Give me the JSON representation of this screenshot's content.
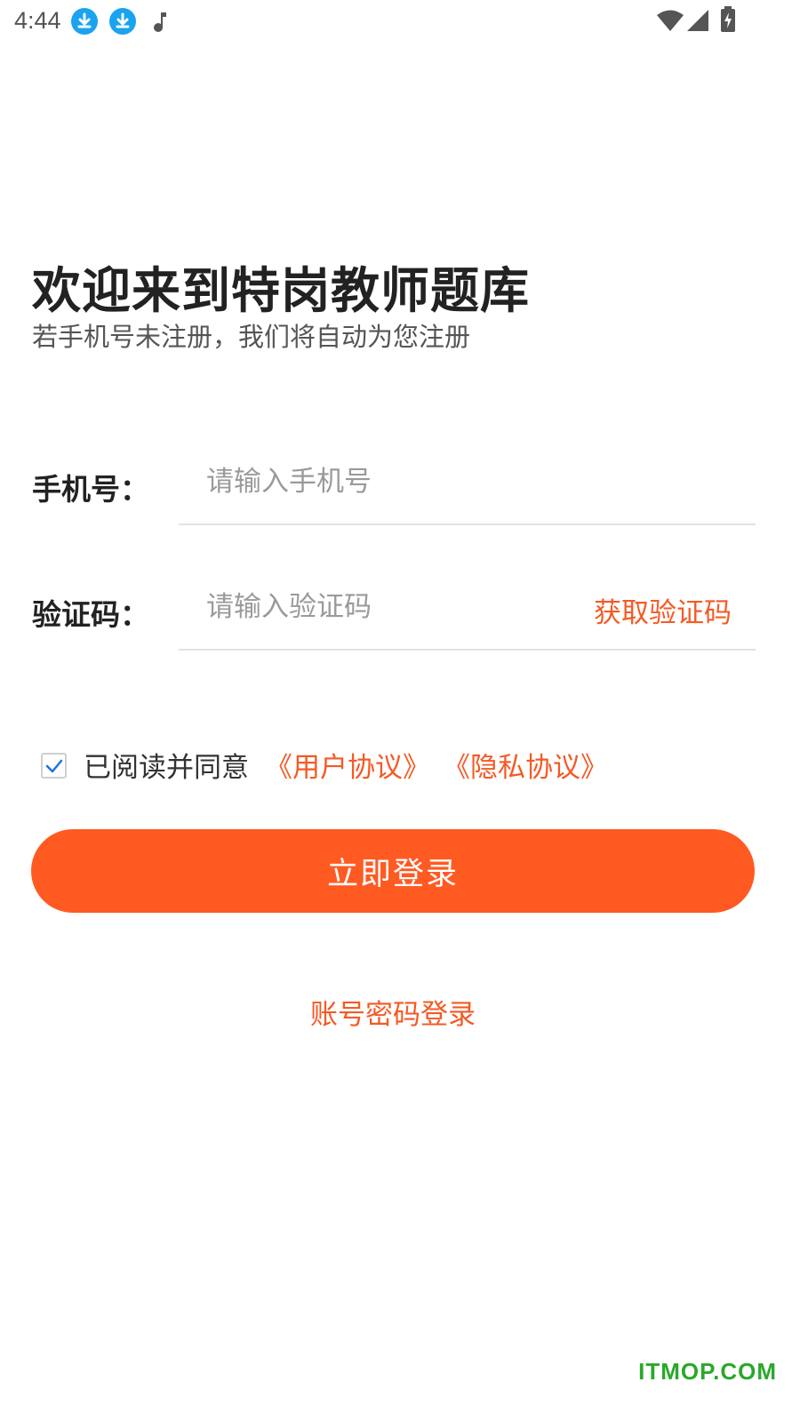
{
  "status_bar": {
    "time": "4:44",
    "icons": [
      "download-icon",
      "download-icon",
      "music-note-icon",
      "wifi-icon",
      "signal-icon",
      "battery-charging-icon"
    ],
    "download_icon_color": "#1aa3ee"
  },
  "header": {
    "title": "欢迎来到特岗教师题库",
    "subtitle": "若手机号未注册，我们将自动为您注册"
  },
  "form": {
    "phone": {
      "label": "手机号：",
      "placeholder": "请输入手机号",
      "value": ""
    },
    "code": {
      "label": "验证码：",
      "placeholder": "请输入验证码",
      "value": "",
      "get_code_label": "获取验证码"
    }
  },
  "agreement": {
    "checked": true,
    "text": "已阅读并同意",
    "user_agreement": "《用户协议》",
    "privacy_agreement": "《隐私协议》"
  },
  "actions": {
    "login_label": "立即登录",
    "password_login_label": "账号密码登录"
  },
  "watermark": "ITMOP.COM",
  "colors": {
    "accent": "#ff5a22",
    "link": "#f45a24",
    "watermark": "#2aa82a",
    "checkmark": "#1a73e8"
  }
}
